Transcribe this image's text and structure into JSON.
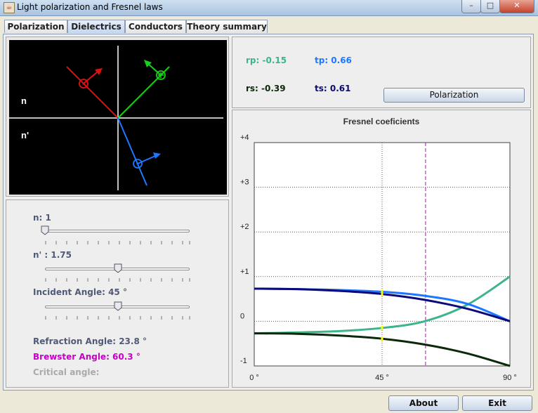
{
  "window": {
    "title": "Light polarization and Fresnel laws",
    "minimize": "–",
    "maximize": "□",
    "close": "✕"
  },
  "tabs": [
    {
      "label": "Polarization",
      "active": false
    },
    {
      "label": "Dielectrics",
      "active": true
    },
    {
      "label": "Conductors",
      "active": false
    },
    {
      "label": "Theory summary",
      "active": false
    }
  ],
  "diagram": {
    "n_label": "n",
    "n2_label": "n'"
  },
  "controls": {
    "n_label": "n: 1",
    "n_value": 1,
    "n2_label": "n' : 1.75",
    "n2_value": 1.75,
    "angle_label": "Incident Angle: 45 °",
    "angle_value": 45,
    "refraction_label": "Refraction Angle: 23.8 °",
    "brewster_label": "Brewster Angle: 60.3 °",
    "critical_label": "Critical angle:"
  },
  "coefficients": {
    "rp": "rp: -0.15",
    "tp": "tp: 0.66",
    "rs": "rs: -0.39",
    "ts": "ts: 0.61"
  },
  "buttons": {
    "polarization": "Polarization",
    "about": "About",
    "exit": "Exit"
  },
  "colors": {
    "rp": "#3cb48c",
    "tp": "#1e78ff",
    "rs": "#0a280a",
    "ts": "#0a0a78",
    "brewster": "#c800c8",
    "refraction": "#505a78",
    "critical": "#aaaaaa"
  },
  "chart_data": {
    "type": "line",
    "title": "Fresnel coeficients",
    "xlim": [
      0,
      90
    ],
    "ylim": [
      -1,
      4
    ],
    "xticks": [
      "0 °",
      "45 °",
      "90 °"
    ],
    "yticks": [
      "+4",
      "+3",
      "+2",
      "+1",
      "0",
      "-1"
    ],
    "markers": {
      "incident_angle": 45,
      "brewster_angle": 60.3
    },
    "series": [
      {
        "name": "rp",
        "color": "#3cb48c",
        "x": [
          0,
          15,
          30,
          45,
          60,
          75,
          90
        ],
        "y": [
          -0.27,
          -0.25,
          -0.22,
          -0.15,
          0.0,
          0.37,
          1.0
        ]
      },
      {
        "name": "tp",
        "color": "#1e78ff",
        "x": [
          0,
          15,
          30,
          45,
          60,
          75,
          90
        ],
        "y": [
          0.73,
          0.72,
          0.7,
          0.66,
          0.57,
          0.39,
          0.0
        ]
      },
      {
        "name": "rs",
        "color": "#0a280a",
        "x": [
          0,
          15,
          30,
          45,
          60,
          75,
          90
        ],
        "y": [
          -0.27,
          -0.28,
          -0.32,
          -0.39,
          -0.52,
          -0.72,
          -1.0
        ]
      },
      {
        "name": "ts",
        "color": "#0a0a78",
        "x": [
          0,
          15,
          30,
          45,
          60,
          75,
          90
        ],
        "y": [
          0.73,
          0.72,
          0.68,
          0.61,
          0.48,
          0.28,
          0.0
        ]
      }
    ]
  }
}
